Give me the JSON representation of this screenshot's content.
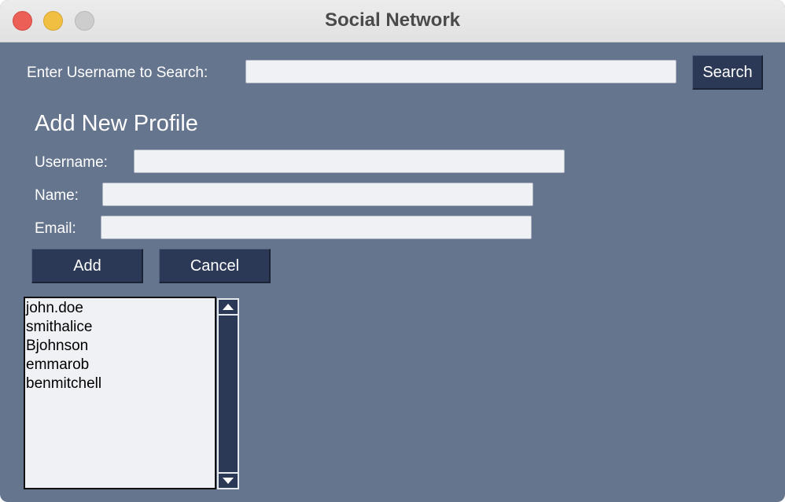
{
  "window": {
    "title": "Social Network"
  },
  "search": {
    "label": "Enter Username to Search:",
    "value": "",
    "button_label": "Search"
  },
  "add_profile": {
    "heading": "Add New Profile",
    "username_label": "Username:",
    "username_value": "",
    "name_label": "Name:",
    "name_value": "",
    "email_label": "Email:",
    "email_value": "",
    "add_label": "Add",
    "cancel_label": "Cancel"
  },
  "profiles": {
    "items": [
      "john.doe",
      "smithalice",
      "Bjohnson",
      "emmarob",
      "benmitchell"
    ]
  },
  "colors": {
    "background": "#66758e",
    "button": "#2b3856",
    "entry": "#eff1f4"
  }
}
